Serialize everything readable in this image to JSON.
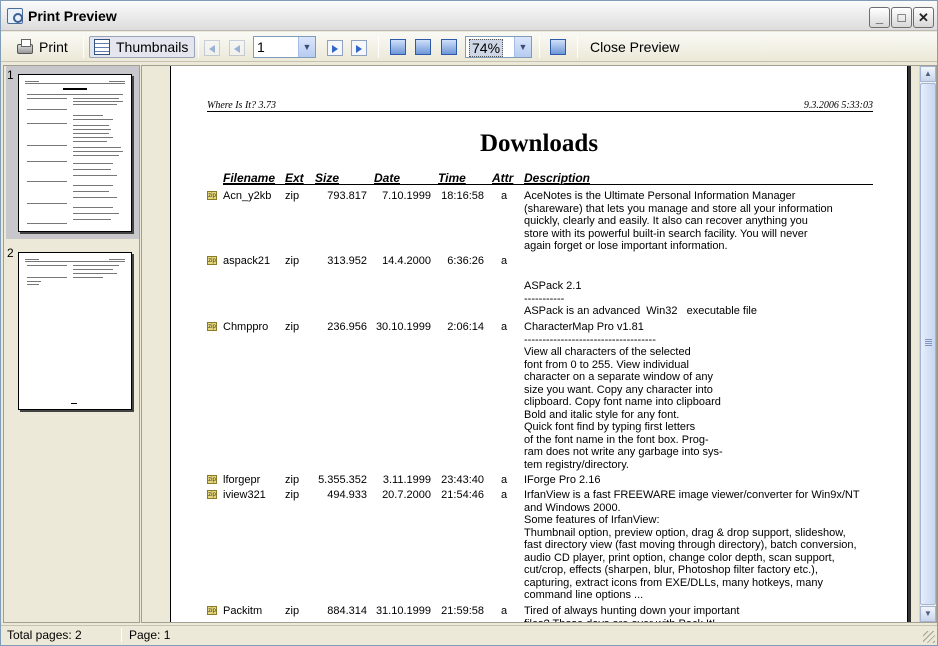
{
  "window": {
    "title": "Print Preview"
  },
  "toolbar": {
    "print_label": "Print",
    "thumbnails_label": "Thumbnails",
    "page_value": "1",
    "zoom_value": "74%",
    "close_label": "Close Preview"
  },
  "thumbnails": [
    {
      "number": "1"
    },
    {
      "number": "2"
    }
  ],
  "document": {
    "header_left": "Where Is It? 3.73",
    "header_right": "9.3.2006 5:33:03",
    "title": "Downloads",
    "columns": [
      "Filename",
      "Ext",
      "Size",
      "Date",
      "Time",
      "Attr",
      "Description"
    ],
    "rows": [
      {
        "filename": "Acn_y2kb",
        "ext": "zip",
        "size": "793.817",
        "date": "7.10.1999",
        "time": "18:16:58",
        "attr": "a",
        "description": "AceNotes is the Ultimate Personal Information Manager\n(shareware) that lets you manage and store all your information\nquickly, clearly and easily. It also can recover anything you\nstore with its powerful built-in search facility. You will never\nagain forget or lose important information."
      },
      {
        "filename": "aspack21",
        "ext": "zip",
        "size": "313.952",
        "date": "14.4.2000",
        "time": "6:36:26",
        "attr": "a",
        "description": "\n\nASPack 2.1\n-----------\nASPack is an advanced  Win32   executable file"
      },
      {
        "filename": "Chmppro",
        "ext": "zip",
        "size": "236.956",
        "date": "30.10.1999",
        "time": "2:06:14",
        "attr": "a",
        "description": "CharacterMap Pro v1.81\n------------------------------------\nView all characters of the selected\nfont from 0 to 255. View individual\ncharacter on a separate window of any\nsize you want. Copy any character into\nclipboard. Copy font name into clipboard\nBold and italic style for any font.\nQuick font find by typing first letters\nof the font name in the font box. Prog-\nram does not write any garbage into sys-\ntem registry/directory."
      },
      {
        "filename": "lforgepr",
        "ext": "zip",
        "size": "5.355.352",
        "date": "3.11.1999",
        "time": "23:43:40",
        "attr": "a",
        "description": "IForge Pro 2.16"
      },
      {
        "filename": "iview321",
        "ext": "zip",
        "size": "494.933",
        "date": "20.7.2000",
        "time": "21:54:46",
        "attr": "a",
        "description": "IrfanView is a fast FREEWARE image viewer/converter for Win9x/NT\nand Windows 2000.\nSome features of IrfanView:\nThumbnail option, preview option, drag & drop support, slideshow,\nfast directory view (fast moving through directory), batch conversion,\naudio CD player, print option, change color depth, scan support,\ncut/crop, effects (sharpen, blur, Photoshop filter factory etc.),\ncapturing, extract icons from EXE/DLLs, many hotkeys, many\ncommand line options ..."
      },
      {
        "filename": "Packitm",
        "ext": "zip",
        "size": "884.314",
        "date": "31.10.1999",
        "time": "21:59:58",
        "attr": "a",
        "description": "Tired of always hunting down your important\nfiles? Those days are over with Pack It!"
      }
    ]
  },
  "status": {
    "total_pages": "Total pages: 2",
    "page": "Page: 1"
  }
}
